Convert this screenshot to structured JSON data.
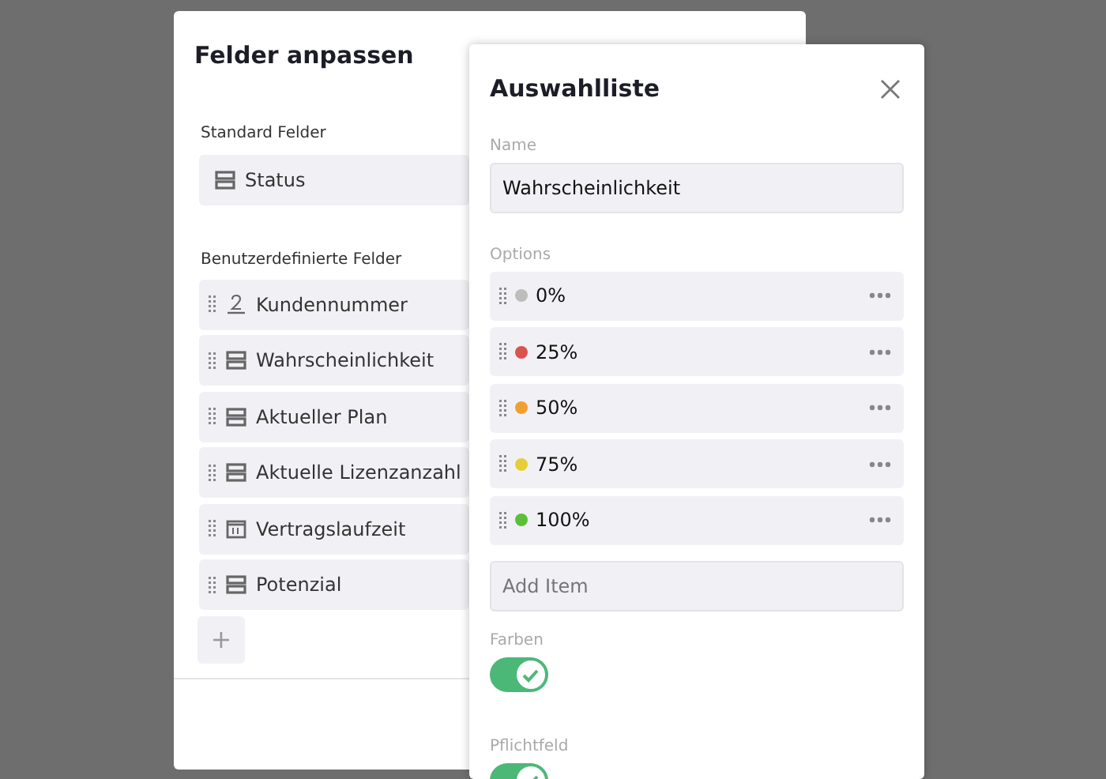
{
  "fields_dialog": {
    "title": "Felder anpassen",
    "standard_label": "Standard Felder",
    "standard_fields": [
      {
        "label": "Status",
        "kind": "select"
      }
    ],
    "custom_label": "Benutzerdefinierte Felder",
    "custom_fields": [
      {
        "label": "Kundennummer",
        "kind": "number"
      },
      {
        "label": "Wahrscheinlichkeit",
        "kind": "select"
      },
      {
        "label": "Aktueller Plan",
        "kind": "select"
      },
      {
        "label": "Aktuelle Lizenzanzahl",
        "kind": "select"
      },
      {
        "label": "Vertragslaufzeit",
        "kind": "date"
      },
      {
        "label": "Potenzial",
        "kind": "select"
      }
    ],
    "add_button": "+"
  },
  "select_panel": {
    "title": "Auswahlliste",
    "name_label": "Name",
    "name_value": "Wahrscheinlichkeit",
    "options_label": "Options",
    "options": [
      {
        "label": "0%",
        "color": "#bdbdbd"
      },
      {
        "label": "25%",
        "color": "#d9534f"
      },
      {
        "label": "50%",
        "color": "#f0a030"
      },
      {
        "label": "75%",
        "color": "#e6cf36"
      },
      {
        "label": "100%",
        "color": "#5cbf3a"
      }
    ],
    "add_item_placeholder": "Add Item",
    "toggles": [
      {
        "label": "Farben",
        "on": true
      },
      {
        "label": "Pflichtfeld",
        "on": true
      }
    ]
  }
}
